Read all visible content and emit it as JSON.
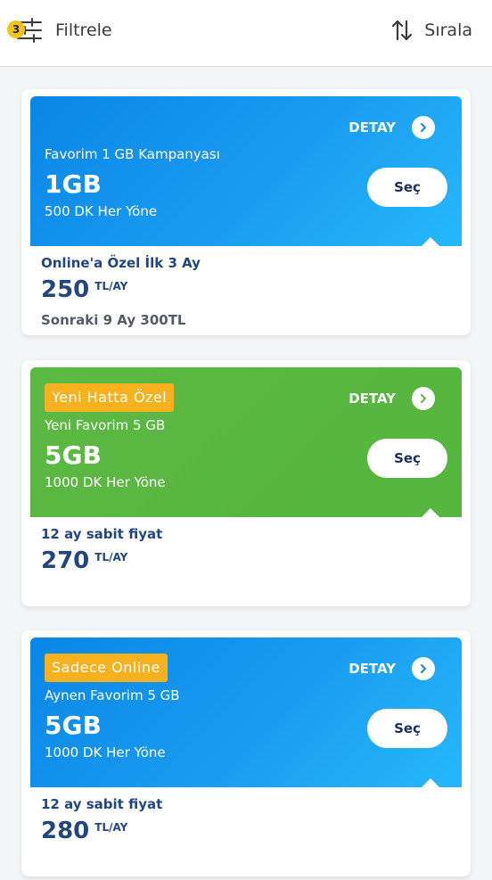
{
  "header": {
    "filter_badge": "3",
    "filter_label": "Filtrele",
    "sort_label": "Sırala"
  },
  "colors": {
    "blue_start": "#0a86e6",
    "blue_end": "#26b8fb",
    "green": "#5cb944",
    "tag": "#f5b21e",
    "price_text": "#24467f"
  },
  "cards": [
    {
      "color": "blue",
      "tag": "",
      "detail_label": "DETAY",
      "name": "Favorim 1 GB Kampanyası",
      "gb": "1GB",
      "minutes": "500 DK Her Yöne",
      "select_label": "Seç",
      "promo": "Online'a Özel İlk 3 Ay",
      "price": "250",
      "price_unit": "TL/AY",
      "next": "Sonraki 9 Ay 300TL"
    },
    {
      "color": "green",
      "tag": "Yeni Hatta Özel",
      "detail_label": "DETAY",
      "name": "Yeni Favorim 5 GB",
      "gb": "5GB",
      "minutes": "1000 DK Her Yöne",
      "select_label": "Seç",
      "promo": "12 ay sabit fiyat",
      "price": "270",
      "price_unit": "TL/AY",
      "next": ""
    },
    {
      "color": "blue",
      "tag": "Sadece Online",
      "detail_label": "DETAY",
      "name": "Aynen Favorim 5 GB",
      "gb": "5GB",
      "minutes": "1000 DK Her Yöne",
      "select_label": "Seç",
      "promo": "12 ay sabit fiyat",
      "price": "280",
      "price_unit": "TL/AY",
      "next": ""
    }
  ]
}
